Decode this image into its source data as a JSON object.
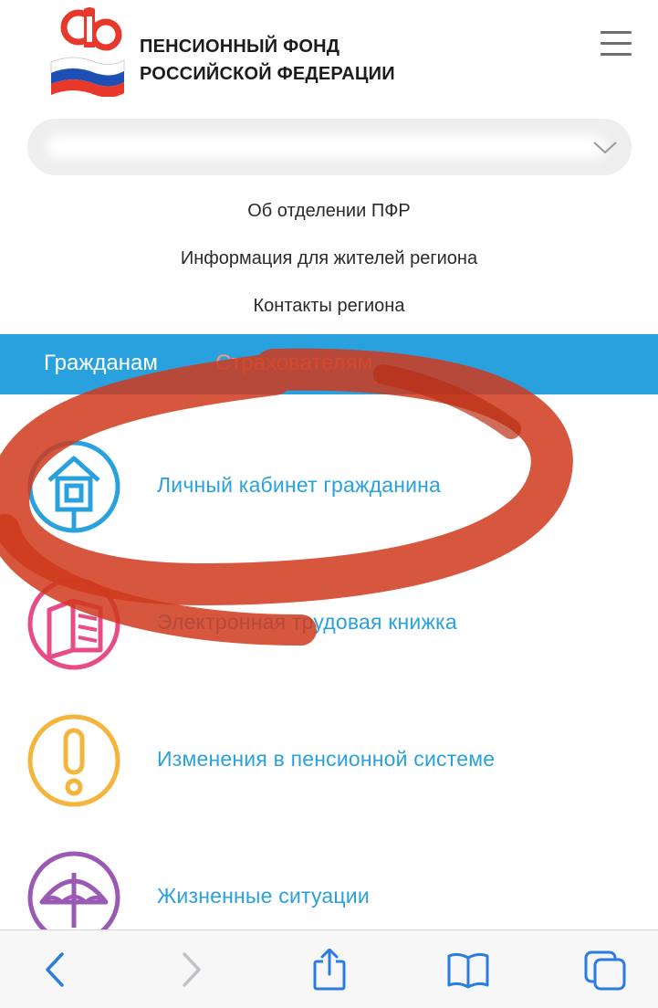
{
  "header": {
    "org_line1": "ПЕНСИОННЫЙ ФОНД",
    "org_line2": "РОССИЙСКОЙ ФЕДЕРАЦИИ",
    "logo_icon": "pfr-logo-icon",
    "menu_icon": "hamburger-menu-icon"
  },
  "region_select": {
    "value": "",
    "icon": "chevron-down-icon"
  },
  "sub_links": [
    {
      "label": "Об отделении  ПФР"
    },
    {
      "label": "Информация для жителей региона"
    },
    {
      "label": "Контакты региона"
    }
  ],
  "tabs": [
    {
      "label": "Гражданам",
      "active": true
    },
    {
      "label": "Страхователям",
      "active": false
    }
  ],
  "services": [
    {
      "label": "Личный кабинет гражданина",
      "icon": "house-icon",
      "color": "#2aa1df"
    },
    {
      "label": "Электронная трудовая книжка",
      "icon": "book-icon",
      "color": "#e74c86"
    },
    {
      "label": "Изменения в пенсионной системе",
      "icon": "exclamation-icon",
      "color": "#f5b43c"
    },
    {
      "label": "Жизненные ситуации",
      "icon": "umbrella-icon",
      "color": "#9b59b6"
    }
  ],
  "browser_bar": {
    "icons": [
      "back-icon",
      "forward-icon",
      "share-icon",
      "bookmarks-icon",
      "tabs-icon"
    ]
  },
  "colors": {
    "accent": "#2aa1df",
    "marker": "#cf3a1c",
    "tab_inactive": "#f39a7a"
  }
}
